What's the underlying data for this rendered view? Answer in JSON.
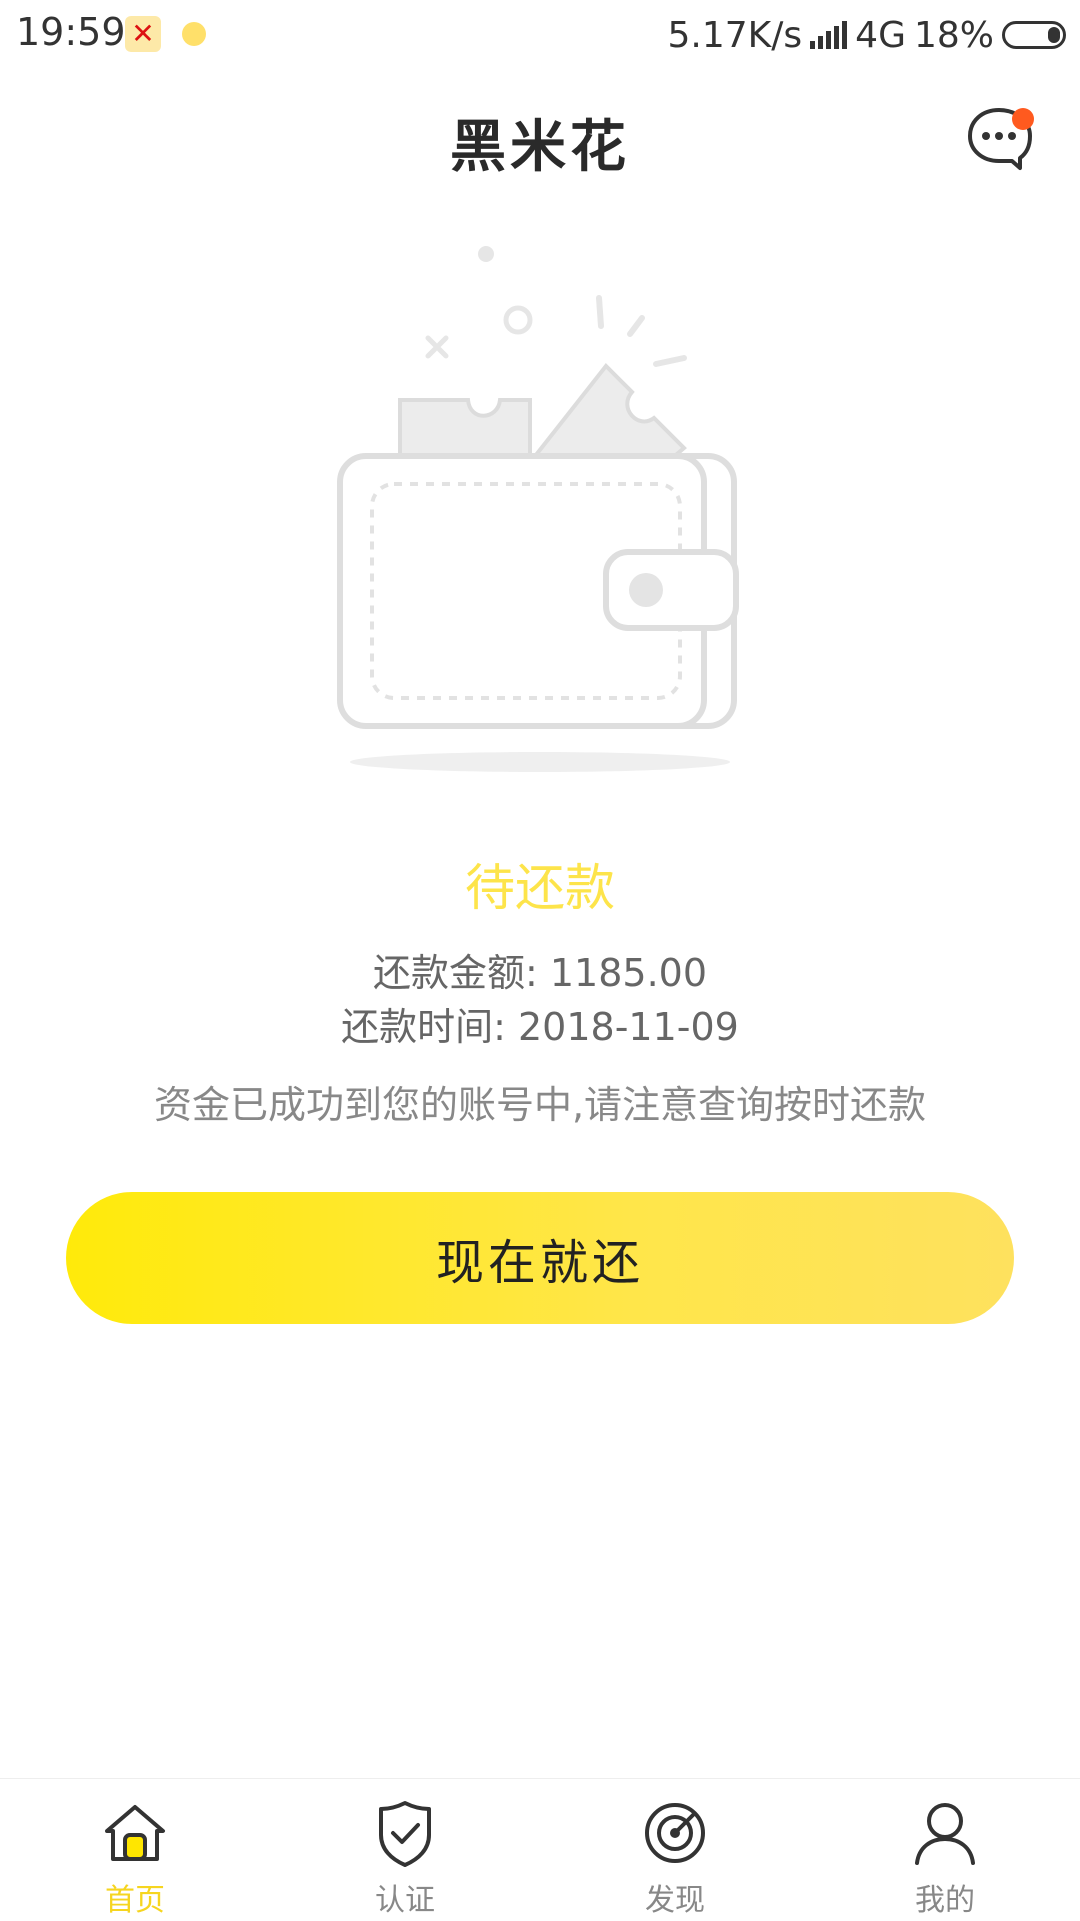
{
  "status_bar": {
    "time": "19:59",
    "app_notification_icon": "app-icon",
    "network_speed": "5.17K/s",
    "network_type": "4G",
    "battery": "18%"
  },
  "header": {
    "title": "黑米花",
    "message_icon": "chat-bubble-icon"
  },
  "illustration": {
    "name": "empty-wallet-illustration"
  },
  "loan_status": {
    "title": "待还款",
    "amount_label": "还款金额: 1185.00",
    "date_label": "还款时间: 2018-11-09",
    "note": "资金已成功到您的账号中,请注意查询按时还款"
  },
  "action": {
    "repay_button_label": "现在就还"
  },
  "tabs": [
    {
      "label": "首页",
      "icon": "home-icon",
      "active": true
    },
    {
      "label": "认证",
      "icon": "shield-check-icon",
      "active": false
    },
    {
      "label": "发现",
      "icon": "compass-icon",
      "active": false
    },
    {
      "label": "我的",
      "icon": "user-icon",
      "active": false
    }
  ],
  "colors": {
    "accent": "#fde44a",
    "badge": "#ff5a1f",
    "button_gradient_start": "#ffea0a",
    "button_gradient_end": "#fee15e"
  }
}
